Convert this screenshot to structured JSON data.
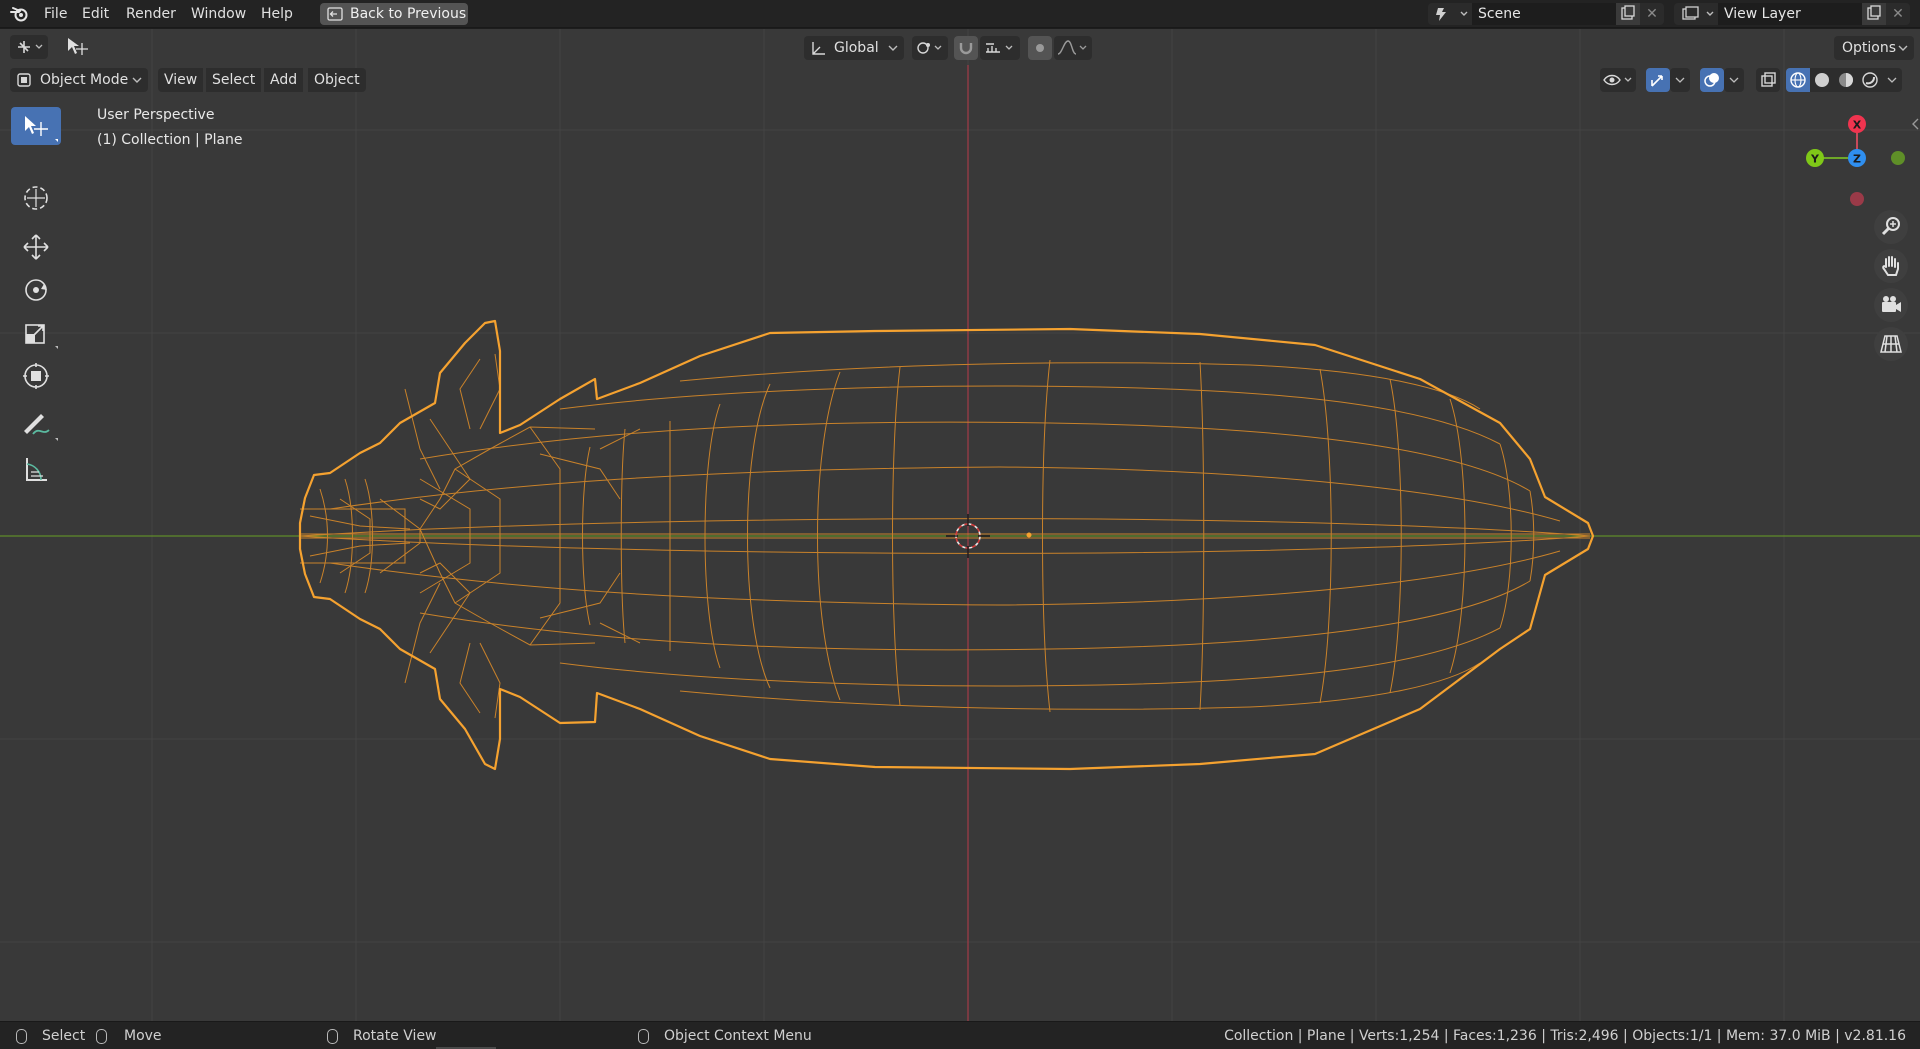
{
  "menu": {
    "file": "File",
    "edit": "Edit",
    "render": "Render",
    "window": "Window",
    "help": "Help",
    "back_button": "Back to Previous"
  },
  "scene": {
    "name": "Scene",
    "close": "✕"
  },
  "view_layer": {
    "name": "View Layer",
    "close": "✕"
  },
  "tool_header": {
    "orientation": "Global",
    "options": "Options"
  },
  "mode_header": {
    "mode": "Object Mode",
    "view": "View",
    "select": "Select",
    "add": "Add",
    "object": "Object"
  },
  "viewport": {
    "perspective": "User Perspective",
    "collection_info": "(1) Collection | Plane",
    "gizmo": {
      "x": "X",
      "y": "Y",
      "z": "Z"
    }
  },
  "statusbar": {
    "select": "Select",
    "move": "Move",
    "rotate_view": "Rotate View",
    "context_menu": "Object Context Menu",
    "stats": "Collection | Plane | Verts:1,254 | Faces:1,236 | Tris:2,496 | Objects:1/1 | Mem: 37.0 MiB | v2.81.16"
  },
  "colors": {
    "accent": "#4772b3",
    "selection": "#f5a230",
    "axis_x": "#a8424e",
    "axis_y": "#6c9a2c",
    "viewport_bg": "#393939"
  }
}
